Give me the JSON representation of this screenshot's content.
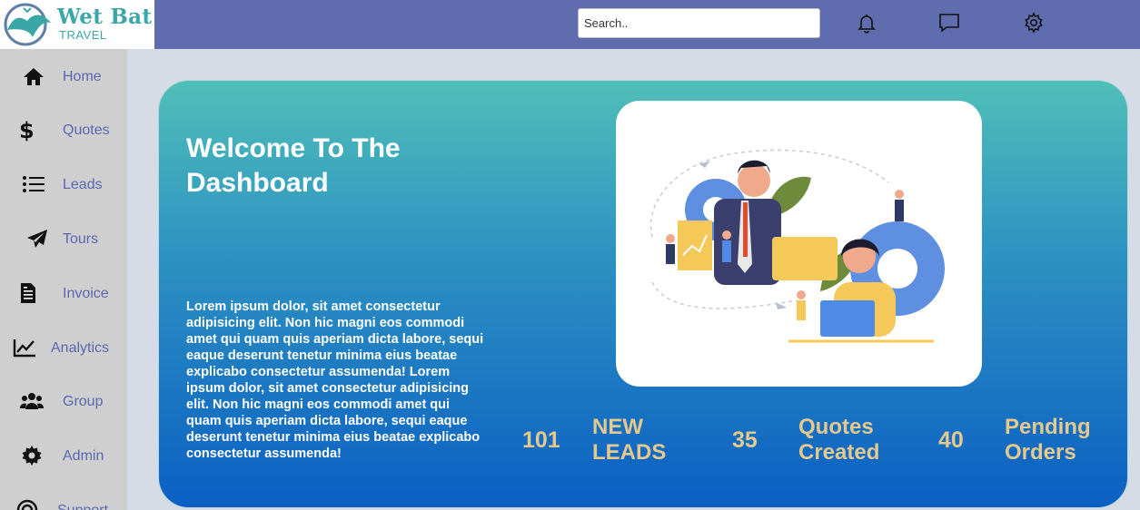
{
  "brand": {
    "name": "Wet Bat",
    "tagline": "TRAVEL",
    "color": "#3aa7a7"
  },
  "search": {
    "placeholder": "Search.."
  },
  "header": {
    "icons": [
      "bell-icon",
      "message-icon",
      "gear-icon"
    ]
  },
  "sidebar": {
    "items": [
      {
        "label": "Home",
        "icon": "home-icon"
      },
      {
        "label": "Quotes",
        "icon": "dollar-icon"
      },
      {
        "label": "Leads",
        "icon": "list-icon"
      },
      {
        "label": "Tours",
        "icon": "paper-plane-icon"
      },
      {
        "label": "Invoice",
        "icon": "invoice-icon"
      },
      {
        "label": "Analytics",
        "icon": "chart-line-icon"
      },
      {
        "label": "Group",
        "icon": "users-icon"
      },
      {
        "label": "Admin",
        "icon": "cog-icon"
      },
      {
        "label": "Support",
        "icon": "support-icon"
      }
    ]
  },
  "hero": {
    "title": "Welcome To The Dashboard",
    "body": "Lorem ipsum dolor, sit amet consectetur adipisicing elit. Non hic magni eos commodi amet qui quam quis aperiam dicta labore, sequi eaque deserunt tenetur minima eius beatae explicabo consectetur assumenda! Lorem ipsum dolor, sit amet consectetur adipisicing elit. Non hic magni eos commodi amet qui quam quis aperiam dicta labore, sequi eaque deserunt tenetur minima eius beatae explicabo consectetur assumenda!"
  },
  "stats": [
    {
      "value": "101",
      "label": "NEW LEADS"
    },
    {
      "value": "35",
      "label": "Quotes Created"
    },
    {
      "value": "40",
      "label": "Pending Orders"
    }
  ],
  "colors": {
    "topbar": "#5f6cae",
    "sidebar": "#cfcfcf",
    "nav_text": "#5a67b0",
    "stat_text": "#e4c88c"
  }
}
